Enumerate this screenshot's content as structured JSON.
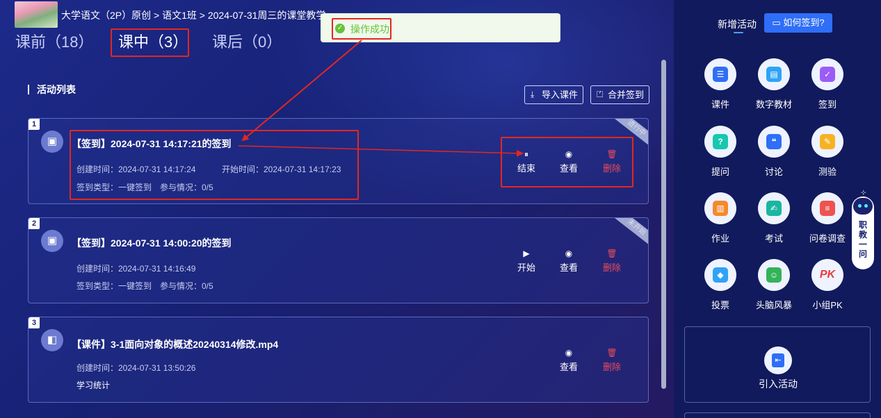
{
  "header": {
    "breadcrumb": "大学语文（2P）原创 > 语文1班 > 2024-07-31周三的课堂教学"
  },
  "tabs": [
    {
      "label": "课前（18）",
      "active": false
    },
    {
      "label": "课中（3）",
      "active": true
    },
    {
      "label": "课后（0）",
      "active": false
    }
  ],
  "toast": {
    "message": "操作成功",
    "icon": "check-circle-icon"
  },
  "activity_list": {
    "title": "活动列表",
    "import_label": "导入课件",
    "merge_label": "合并签到"
  },
  "activities": [
    {
      "index": "1",
      "title": "【签到】2024-07-31 14:17:21的签到",
      "created": "创建时间：2024-07-31 14:17:24",
      "started": "开始时间：2024-07-31 14:17:23",
      "type": "签到类型：一键签到",
      "participation": "参与情况：0/5",
      "status": "进行中",
      "primary_action": "结束",
      "view": "查看",
      "delete": "删除"
    },
    {
      "index": "2",
      "title": "【签到】2024-07-31 14:00:20的签到",
      "created": "创建时间：2024-07-31 14:16:49",
      "type": "签到类型：一键签到",
      "participation": "参与情况：0/5",
      "status": "未开始",
      "primary_action": "开始",
      "view": "查看",
      "delete": "删除"
    },
    {
      "index": "3",
      "title": "【课件】3-1面向对象的概述20240314修改.mp4",
      "created": "创建时间：2024-07-31 13:50:26",
      "stats": "学习统计",
      "view": "查看",
      "delete": "删除"
    }
  ],
  "sidebar": {
    "title": "新增活动",
    "help_label": "如何签到?",
    "tools": [
      {
        "label": "课件",
        "icon": "courseware-icon",
        "color": "#2f6ef6"
      },
      {
        "label": "数字教材",
        "icon": "digital-textbook-icon",
        "color": "#2fa3f6"
      },
      {
        "label": "签到",
        "icon": "checkin-icon",
        "color": "#9b5cf6"
      },
      {
        "label": "提问",
        "icon": "question-icon",
        "color": "#17c7b0"
      },
      {
        "label": "讨论",
        "icon": "discussion-icon",
        "color": "#2f6ef6"
      },
      {
        "label": "测验",
        "icon": "quiz-icon",
        "color": "#f5b324"
      },
      {
        "label": "作业",
        "icon": "homework-icon",
        "color": "#f5892c"
      },
      {
        "label": "考试",
        "icon": "exam-icon",
        "color": "#19b6a0"
      },
      {
        "label": "问卷调查",
        "icon": "survey-icon",
        "color": "#ef5350"
      },
      {
        "label": "投票",
        "icon": "vote-icon",
        "color": "#2fa3f6"
      },
      {
        "label": "头脑风暴",
        "icon": "brainstorm-icon",
        "color": "#33b35a"
      },
      {
        "label": "小组PK",
        "icon": "group-pk-icon",
        "color": "#ef3b3b",
        "text": "PK"
      }
    ],
    "import_activity": "引入活动",
    "assistant": "职教一问"
  },
  "colors": {
    "annotation": "#e5261f",
    "success": "#67c23a",
    "danger": "#ea4b5a",
    "accent": "#2f6ef6"
  }
}
